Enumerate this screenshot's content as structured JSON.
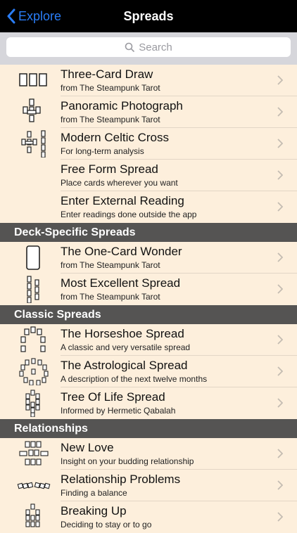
{
  "navbar": {
    "back_label": "Explore",
    "title": "Spreads"
  },
  "search": {
    "placeholder": "Search"
  },
  "rows_main": [
    {
      "title": "Three-Card Draw",
      "subtitle": "from The Steampunk Tarot",
      "icon": "three-card-icon"
    },
    {
      "title": "Panoramic Photograph",
      "subtitle": "from The Steampunk Tarot",
      "icon": "panoramic-spread-icon"
    },
    {
      "title": "Modern Celtic Cross",
      "subtitle": "For long-term analysis",
      "icon": "celtic-cross-icon"
    },
    {
      "title": "Free Form Spread",
      "subtitle": "Place cards wherever you want",
      "icon": ""
    },
    {
      "title": "Enter External Reading",
      "subtitle": "Enter readings done outside the app",
      "icon": ""
    }
  ],
  "sections": {
    "deck_specific": "Deck-Specific Spreads",
    "classic": "Classic Spreads",
    "relationships": "Relationships"
  },
  "rows_deck": [
    {
      "title": "The One-Card Wonder",
      "subtitle": "from The Steampunk Tarot",
      "icon": "single-card-icon"
    },
    {
      "title": "Most Excellent Spread",
      "subtitle": "from The Steampunk Tarot",
      "icon": "two-column-spread-icon"
    }
  ],
  "rows_classic": [
    {
      "title": "The Horseshoe Spread",
      "subtitle": "A classic and very versatile spread",
      "icon": "horseshoe-spread-icon"
    },
    {
      "title": "The Astrological Spread",
      "subtitle": "A description of the next twelve months",
      "icon": "astrological-circle-icon"
    },
    {
      "title": "Tree Of Life Spread",
      "subtitle": "Informed by Hermetic Qabalah",
      "icon": "tree-of-life-icon"
    }
  ],
  "rows_rel": [
    {
      "title": "New Love",
      "subtitle": "Insight on your budding relationship",
      "icon": "new-love-spread-icon"
    },
    {
      "title": "Relationship Problems",
      "subtitle": "Finding a balance",
      "icon": "relationship-problems-icon"
    },
    {
      "title": "Breaking Up",
      "subtitle": "Deciding to stay or to go",
      "icon": "breaking-up-spread-icon"
    }
  ],
  "colors": {
    "navbar_bg": "#000000",
    "accent": "#2a7df6",
    "list_bg": "#fdefdc",
    "section_bg": "#555453"
  }
}
